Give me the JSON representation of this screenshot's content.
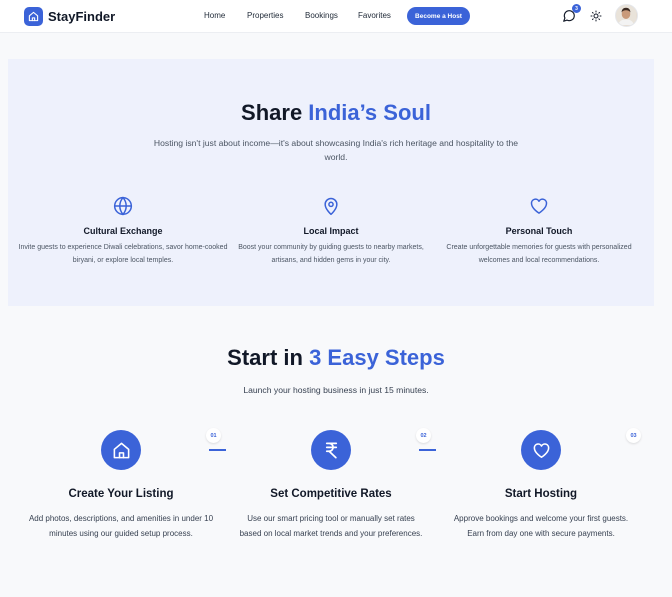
{
  "nav": {
    "brand": "StayFinder",
    "links": [
      "Home",
      "Properties",
      "Bookings",
      "Favorites"
    ],
    "cta": "Become a Host",
    "notification_count": "3",
    "icons": {
      "logo": "home-icon",
      "notifications": "chat-bubble-icon",
      "theme": "sun-icon",
      "avatar": "user-avatar"
    }
  },
  "soul": {
    "title_plain": "Share ",
    "title_accent": "India’s Soul",
    "subtitle": "Hosting isn't just about income—it's about showcasing India's rich heritage and hospitality to the world.",
    "features": [
      {
        "icon": "globe-icon",
        "title": "Cultural Exchange",
        "desc": "Invite guests to experience Diwali celebrations, savor home-cooked biryani, or explore local temples."
      },
      {
        "icon": "map-pin-icon",
        "title": "Local Impact",
        "desc": "Boost your community by guiding guests to nearby markets, artisans, and hidden gems in your city."
      },
      {
        "icon": "heart-icon",
        "title": "Personal Touch",
        "desc": "Create unforgettable memories for guests with personalized welcomes and local recommendations."
      }
    ]
  },
  "steps": {
    "title_plain": "Start in ",
    "title_accent": "3 Easy Steps",
    "subtitle": "Launch your hosting business in just 15 minutes.",
    "items": [
      {
        "num": "01",
        "icon": "home-icon",
        "title": "Create Your Listing",
        "desc": "Add photos, descriptions, and amenities in under 10 minutes using our guided setup process."
      },
      {
        "num": "02",
        "icon": "rupee-icon",
        "title": "Set Competitive Rates",
        "desc": "Use our smart pricing tool or manually set rates based on local market trends and your preferences."
      },
      {
        "num": "03",
        "icon": "heart-icon",
        "title": "Start Hosting",
        "desc": "Approve bookings and welcome your first guests. Earn from day one with secure payments."
      }
    ]
  },
  "colors": {
    "accent": "#3b63d8",
    "soul_bg": "#eef1fc",
    "page_bg": "#f8f9fb"
  }
}
